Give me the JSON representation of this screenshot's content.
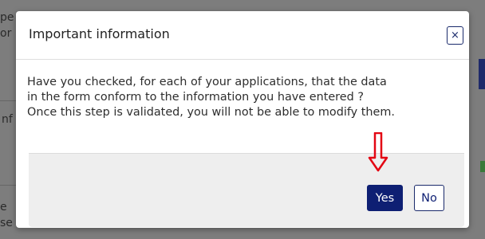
{
  "modal": {
    "title": "Important information",
    "close_symbol": "×",
    "body_lines": [
      "Have you checked, for each of your applications, that the data",
      "in the form  conform to the information you have entered ?",
      "Once this step is validated, you will not be able to modify them."
    ],
    "yes_label": "Yes",
    "no_label": "No"
  },
  "annotation": {
    "arrow_color": "#e30613",
    "icon": "arrow-down-icon"
  },
  "colors": {
    "primary": "#0e1f73",
    "overlay": "#7d7d7d"
  }
}
